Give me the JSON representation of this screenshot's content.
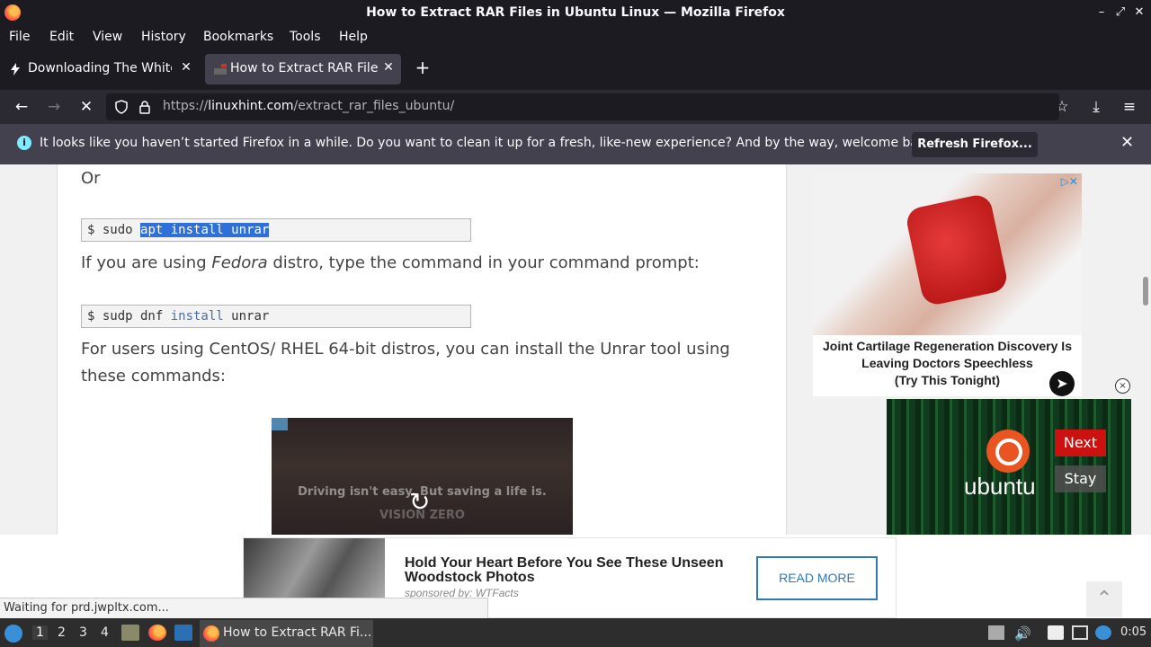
{
  "window": {
    "title": "How to Extract RAR Files in Ubuntu Linux — Mozilla Firefox"
  },
  "menu": [
    "File",
    "Edit",
    "View",
    "History",
    "Bookmarks",
    "Tools",
    "Help"
  ],
  "tabs": [
    {
      "label": "Downloading The White H",
      "active": false
    },
    {
      "label": "How to Extract RAR Files",
      "active": true
    }
  ],
  "nav": {
    "url_prefix": "https://",
    "url_domain": "linuxhint.com",
    "url_path": "/extract_rar_files_ubuntu/"
  },
  "notification": {
    "message": "It looks like you haven’t started Firefox in a while. Do you want to clean it up for a fresh, like-new experience? And by the way, welcome back!",
    "button": "Refresh Firefox..."
  },
  "article": {
    "or_text": "Or",
    "code1_prompt": "$ sudo ",
    "code1_selected": "apt install unrar",
    "para_fedora_before": "If you are using ",
    "para_fedora_em": "Fedora",
    "para_fedora_after": " distro, type the command in your command prompt:",
    "code2_prompt": "$ sudp dnf ",
    "code2_kw": "install",
    "code2_rest": " unrar",
    "para_centos_line1": "For users using CentOS/ RHEL 64-bit distros, you can install the Unrar tool using",
    "para_centos_line2": "these commands:",
    "video_text": "Driving isn't easy. But saving a life is.",
    "video_text2": "VISION ZERO"
  },
  "side_ad": {
    "caption_line1": "Joint Cartilage Regeneration Discovery Is",
    "caption_line2": "Leaving Doctors Speechless",
    "caption_line3": "(Try This Tonight)"
  },
  "video_ad": {
    "brand": "ubuntu",
    "next_label": "Next",
    "stay_label": "Stay"
  },
  "banner_ad": {
    "headline": "Hold Your Heart Before You See These Unseen Woodstock Photos",
    "sponsor": "sponsored by: WTFacts",
    "button": "READ MORE"
  },
  "status_text": "Waiting for prd.jwpltx.com...",
  "taskbar": {
    "workspaces": [
      "1",
      "2",
      "3",
      "4"
    ],
    "current_workspace": "1",
    "task_label": "How to Extract RAR Fi...",
    "clock": "0:05"
  },
  "colors": {
    "chrome_dark": "#1c1b22",
    "accent_blue": "#2c7ab8",
    "selection": "#2e6fd8"
  }
}
